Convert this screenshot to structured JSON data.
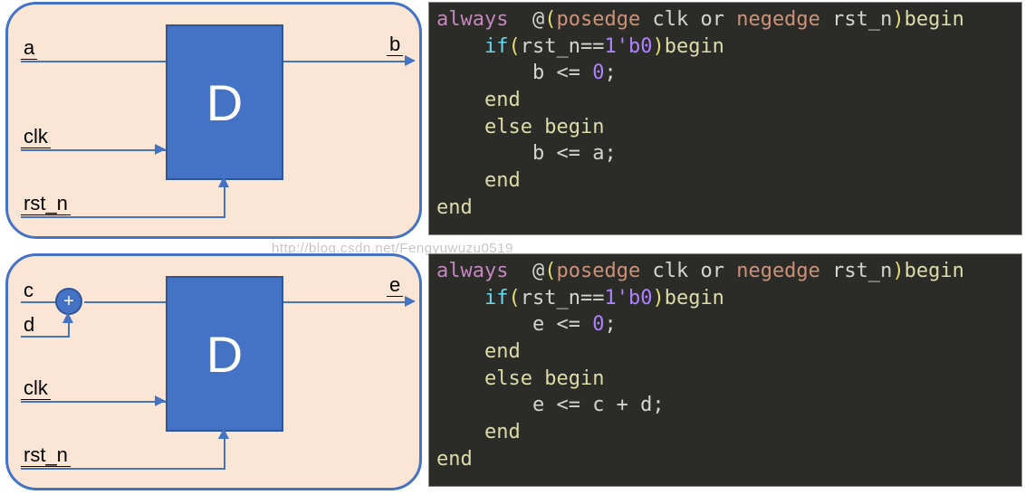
{
  "watermark": "http://blog.csdn.net/Fengyuwuzu0519",
  "diagram1": {
    "d_label": "D",
    "sig_a": "a",
    "sig_b": "b",
    "sig_clk": "clk",
    "sig_rst": "rst_n"
  },
  "diagram2": {
    "d_label": "D",
    "sig_c": "c",
    "sig_d": "d",
    "sig_e": "e",
    "sig_clk": "clk",
    "sig_rst": "rst_n",
    "adder": "+"
  },
  "code1": {
    "always": "always",
    "at": "@",
    "lparen": "(",
    "posedge": "posedge",
    "clk": "clk",
    "or": "or",
    "negedge": "negedge",
    "rst": "rst_n",
    "rparen": ")",
    "begin": "begin",
    "if": "if",
    "cond_l": "(",
    "cond_rst": "rst_n",
    "eq": "==",
    "one_b0": "1'b0",
    "cond_r": ")",
    "stmt1": "b <= ",
    "zero": "0",
    "semi": ";",
    "end": "end",
    "else": "else",
    "stmt2a": "b <= a;",
    "end2": "end",
    "end3": "end"
  },
  "code2": {
    "always": "always",
    "at": "@",
    "lparen": "(",
    "posedge": "posedge",
    "clk": "clk",
    "or": "or",
    "negedge": "negedge",
    "rst": "rst_n",
    "rparen": ")",
    "begin": "begin",
    "if": "if",
    "cond_l": "(",
    "cond_rst": "rst_n",
    "eq": "==",
    "one_b0": "1'b0",
    "cond_r": ")",
    "stmt1": "e <= ",
    "zero": "0",
    "semi": ";",
    "end": "end",
    "else": "else",
    "stmt2a": "e <= c + d;",
    "end2": "end",
    "end3": "end"
  }
}
